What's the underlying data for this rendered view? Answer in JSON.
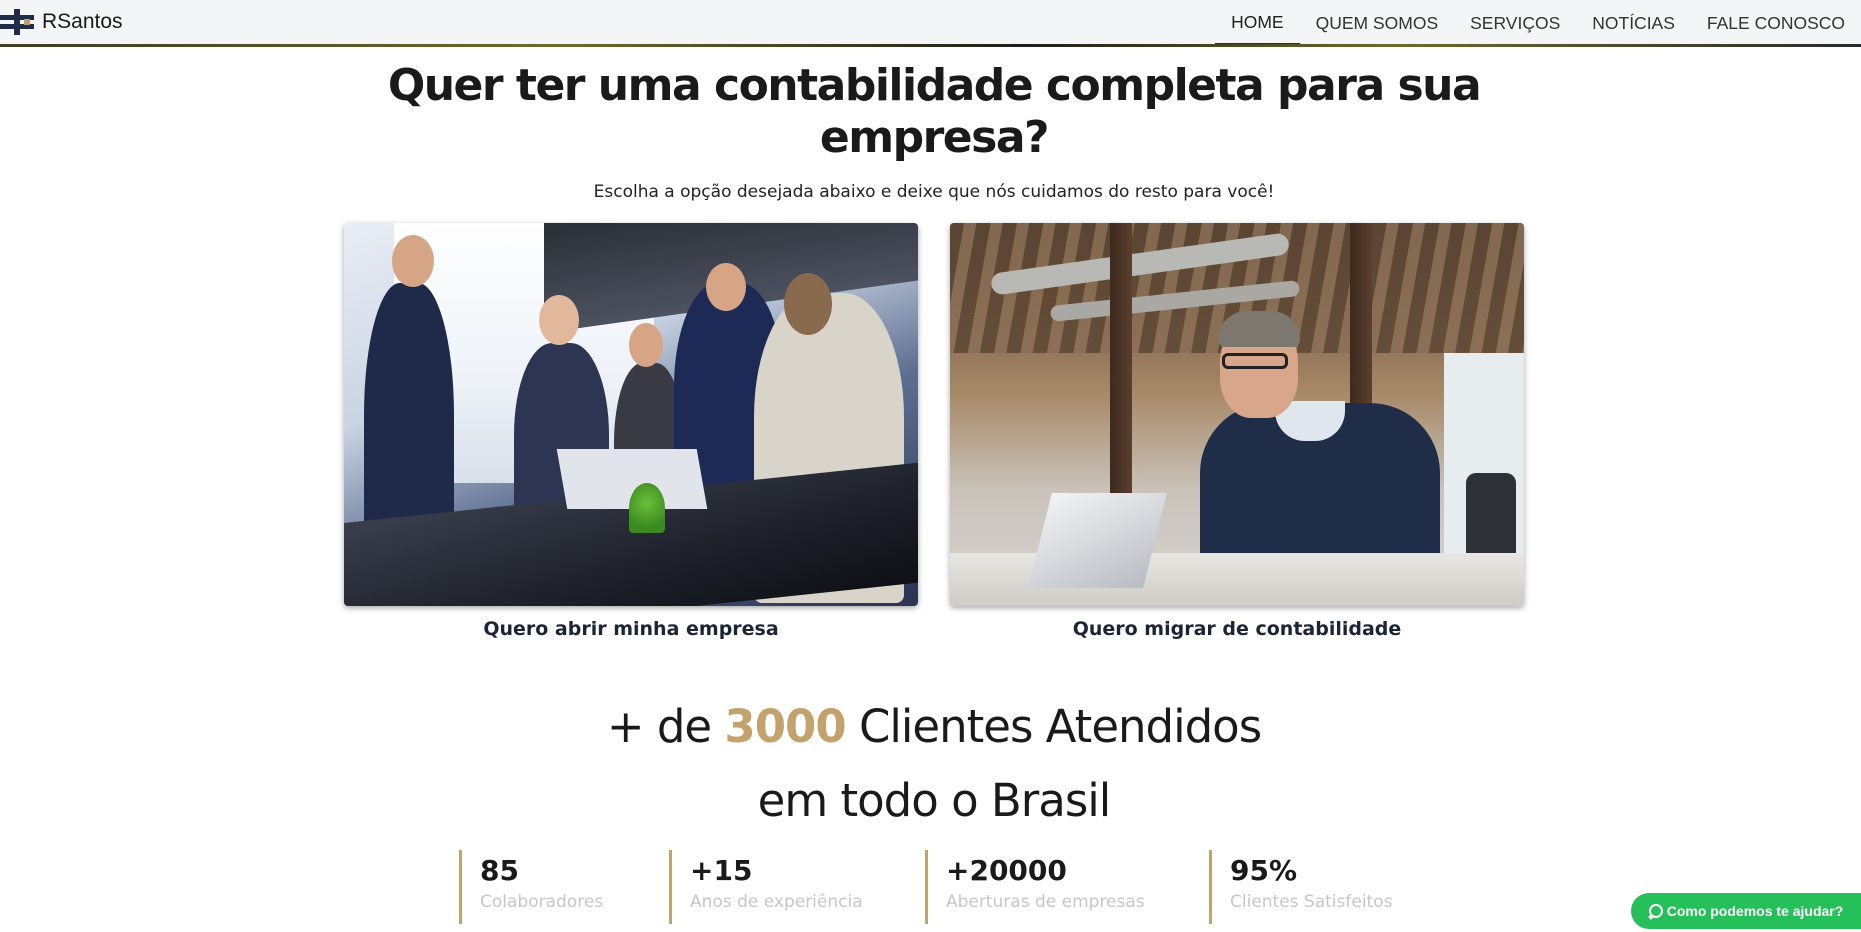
{
  "navbar": {
    "brand_name": "RSantos",
    "links": [
      {
        "label": "HOME",
        "active": true
      },
      {
        "label": "QUEM SOMOS",
        "active": false
      },
      {
        "label": "SERVIÇOS",
        "active": false
      },
      {
        "label": "NOTÍCIAS",
        "active": false
      },
      {
        "label": "FALE CONOSCO",
        "active": false
      }
    ]
  },
  "hero": {
    "title_line1": "Quer ter uma contabilidade completa para sua",
    "title_line2": "empresa?",
    "subtitle": "Escolha a opção desejada abaixo e deixe que nós cuidamos do resto para você!"
  },
  "cards": [
    {
      "caption": "Quero abrir minha empresa",
      "image": "business-meeting-handshake-photo"
    },
    {
      "caption": "Quero migrar de contabilidade",
      "image": "man-on-phone-laptop-office-photo"
    }
  ],
  "clients": {
    "prefix": "+ de ",
    "number": "3000",
    "suffix": " Clientes Atendidos",
    "line2": "em todo o Brasil"
  },
  "stats": [
    {
      "value": "85",
      "label": "Colaboradores"
    },
    {
      "value": "+15",
      "label": "Anos de experiência"
    },
    {
      "value": "+20000",
      "label": "Aberturas de empresas"
    },
    {
      "value": "95%",
      "label": "Clientes Satisfeitos"
    }
  ],
  "whatsapp": {
    "label": "Como podemos te ajudar?",
    "icon": "whatsapp-icon"
  },
  "colors": {
    "accent_gold": "#c3a26c",
    "whatsapp_green": "#25c05a",
    "brand_navy": "#1f2d4a"
  }
}
